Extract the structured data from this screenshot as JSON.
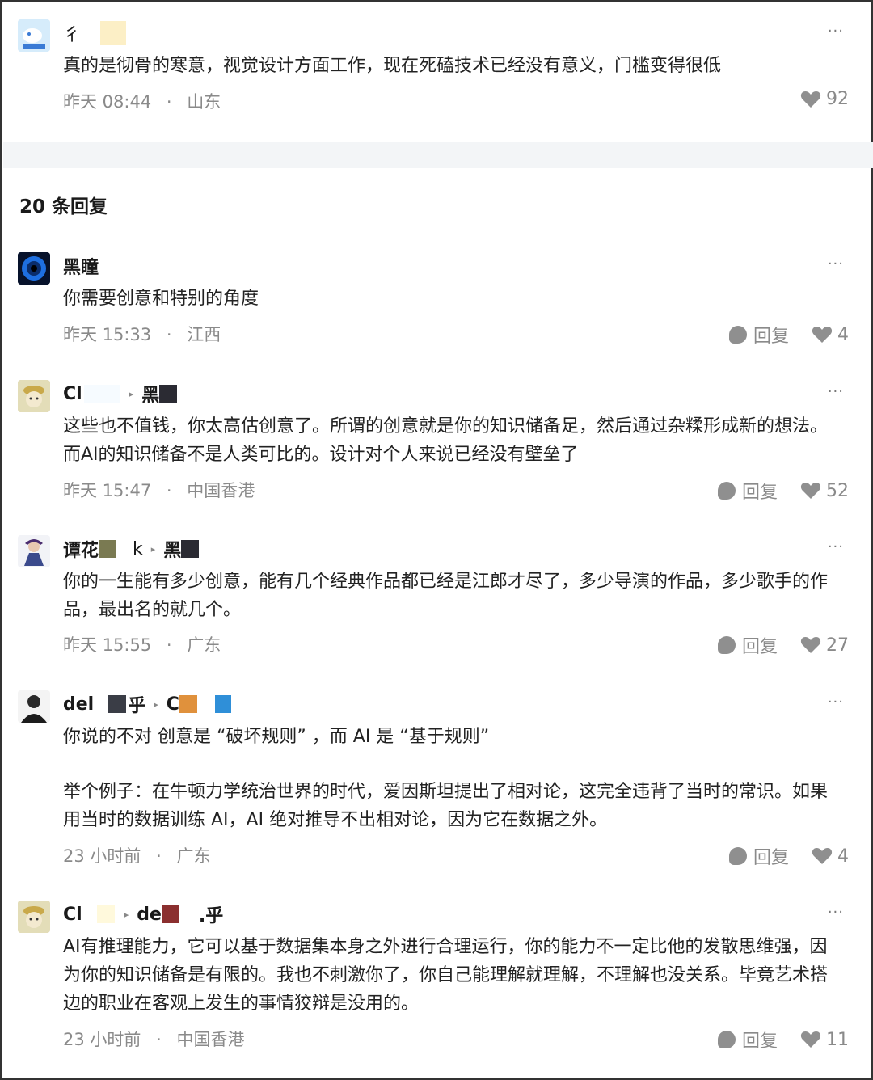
{
  "main_post": {
    "author": "彳",
    "text": "真的是彻骨的寒意，视觉设计方面工作，现在死磕技术已经没有意义，门槛变得很低",
    "time": "昨天 08:44",
    "location": "山东",
    "likes": "92",
    "more": "···"
  },
  "replies_header": {
    "count_label": "20 条回复"
  },
  "comments": [
    {
      "author": "黑瞳",
      "text": "你需要创意和特别的角度",
      "time": "昨天 15:33",
      "location": "江西",
      "reply_label": "回复",
      "likes": "4",
      "more": "···"
    },
    {
      "author": "Cl",
      "reply_to": "黑",
      "text": "这些也不值钱，你太高估创意了。所谓的创意就是你的知识储备足，然后通过杂糅形成新的想法。而AI的知识储备不是人类可比的。设计对个人来说已经没有壁垒了",
      "time": "昨天 15:47",
      "location": "中国香港",
      "reply_label": "回复",
      "likes": "52",
      "more": "···"
    },
    {
      "author": "谭花",
      "author_suffix": "k",
      "reply_to": "黑",
      "text": "你的一生能有多少创意，能有几个经典作品都已经是江郎才尽了，多少导演的作品，多少歌手的作品，最出名的就几个。",
      "time": "昨天 15:55",
      "location": "广东",
      "reply_label": "回复",
      "likes": "27",
      "more": "···"
    },
    {
      "author": "del",
      "author_suffix": "乎",
      "reply_to": "C",
      "text_line1": "你说的不对 创意是 “破坏规则” ，而 AI 是 “基于规则”",
      "text_para2": "举个例子：在牛顿力学统治世界的时代，爱因斯坦提出了相对论，这完全违背了当时的常识。如果用当时的数据训练 AI，AI 绝对推导不出相对论，因为它在数据之外。",
      "time": "23 小时前",
      "location": "广东",
      "reply_label": "回复",
      "likes": "4",
      "more": "···"
    },
    {
      "author": "Cl",
      "reply_to": "de",
      "reply_to_suffix": ".乎",
      "text": "AI有推理能力，它可以基于数据集本身之外进行合理运行，你的能力不一定比他的发散思维强，因为你的知识储备是有限的。我也不刺激你了，你自己能理解就理解，不理解也没关系。毕竟艺术搭边的职业在客观上发生的事情狡辩是没用的。",
      "time": "23 小时前",
      "location": "中国香港",
      "reply_label": "回复",
      "likes": "11",
      "more": "···"
    }
  ],
  "separator": "·",
  "colors": {
    "meta": "#8a8a8a",
    "icon": "#8f8f8f",
    "band": "#f3f5f7"
  }
}
